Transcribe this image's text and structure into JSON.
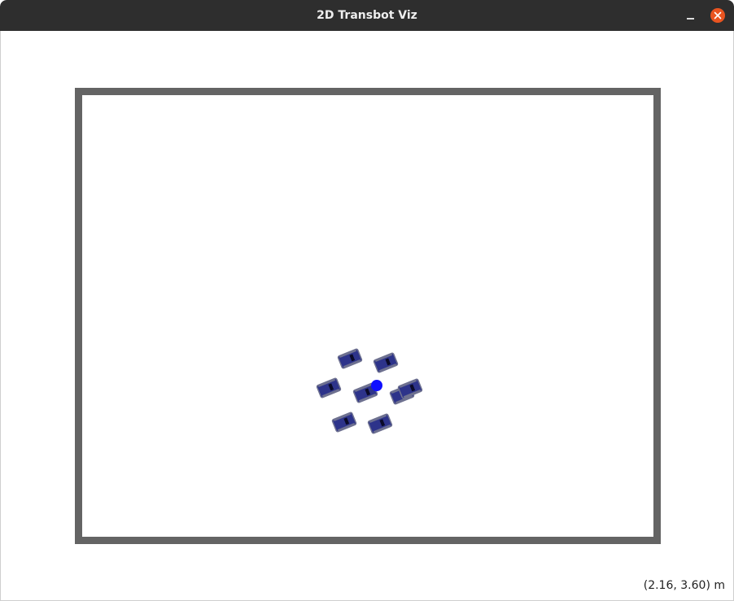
{
  "window": {
    "title": "2D Transbot Viz",
    "controls": {
      "minimize_icon": "minimize-icon",
      "close_icon": "close-icon"
    }
  },
  "viz": {
    "colors": {
      "wall": "#646464",
      "robot_body": "#2d338a",
      "robot_outline": "#6e7190",
      "robot_marker": "#0a0a28",
      "target": "#1010ff"
    },
    "robot_count": 8,
    "target_shown": true,
    "coord_readout": "(2.16, 3.60) m"
  }
}
